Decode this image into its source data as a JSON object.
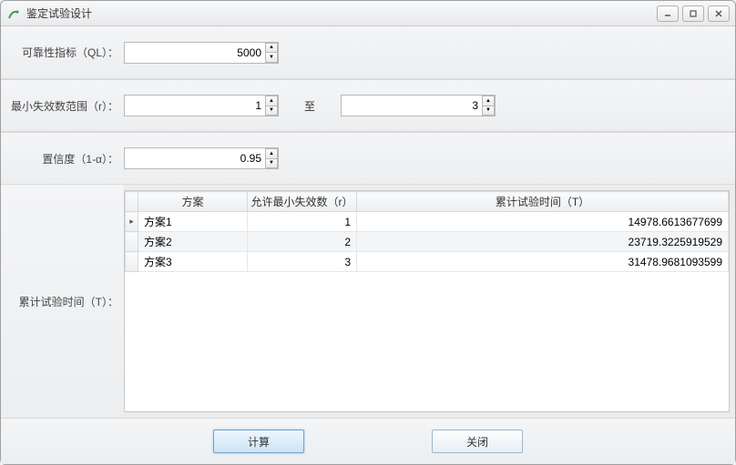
{
  "window": {
    "title": "鉴定试验设计"
  },
  "fields": {
    "ql_label": "可靠性指标（QL）：",
    "ql_value": "5000",
    "r_label": "最小失效数范围（r）：",
    "r_from": "1",
    "to_label": "至",
    "r_to": "3",
    "conf_label": "置信度（1-α）：",
    "conf_value": "0.95",
    "table_label": "累计试验时间（T）："
  },
  "table": {
    "headers": {
      "scheme": "方案",
      "r": "允许最小失效数（r）",
      "t": "累计试验时间（T）"
    },
    "rows": [
      {
        "scheme": "方案1",
        "r": "1",
        "t": "14978.6613677699",
        "marker": "▸"
      },
      {
        "scheme": "方案2",
        "r": "2",
        "t": "23719.3225919529",
        "marker": ""
      },
      {
        "scheme": "方案3",
        "r": "3",
        "t": "31478.9681093599",
        "marker": ""
      }
    ]
  },
  "buttons": {
    "compute": "计算",
    "close": "关闭"
  }
}
